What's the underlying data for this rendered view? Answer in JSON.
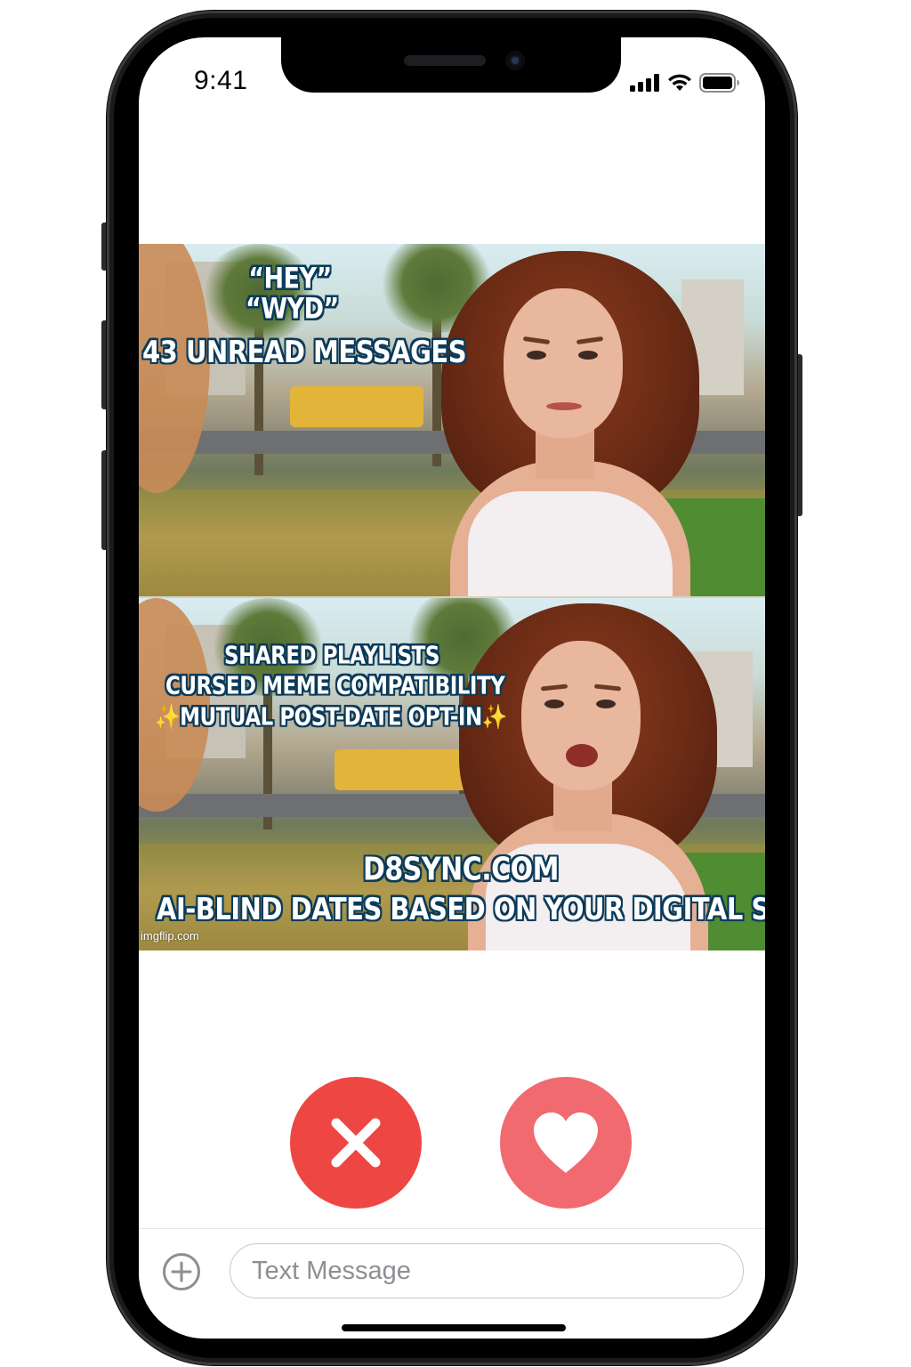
{
  "status_bar": {
    "time": "9:41",
    "icons": [
      "signal-icon",
      "wifi-icon",
      "battery-icon"
    ]
  },
  "meme": {
    "top_panel": {
      "line1": "“HEY”",
      "line2": "“WYD”",
      "line3": "43 UNREAD MESSAGES"
    },
    "bottom_panel": {
      "line1": "SHARED PLAYLISTS",
      "line2": "CURSED MEME COMPATIBILITY",
      "line3_sparkle_left": "✨",
      "line3": "MUTUAL POST-DATE OPT-IN",
      "line3_sparkle_right": "✨",
      "site": "D8SYNC.COM",
      "tagline": "AI-BLIND DATES BASED ON YOUR DIGITAL SOUL",
      "watermark": "imgflip.com"
    }
  },
  "actions": {
    "nope_icon": "close-icon",
    "like_icon": "heart-icon",
    "nope_color": "#ee4643",
    "like_color": "#f06a70"
  },
  "compose": {
    "plus_icon": "plus-circle-icon",
    "placeholder": "Text Message"
  }
}
